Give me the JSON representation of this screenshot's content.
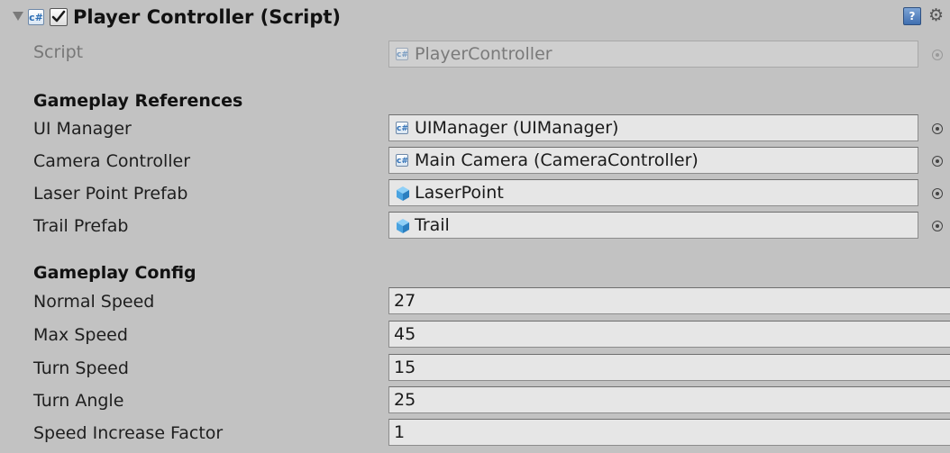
{
  "component": {
    "title": "Player Controller (Script)",
    "enabled": true,
    "script_label": "Script",
    "script_value": "PlayerController"
  },
  "sections": {
    "references_title": "Gameplay References",
    "config_title": "Gameplay Config"
  },
  "references": [
    {
      "label": "UI Manager",
      "value": "UIManager (UIManager)",
      "icon": "script-icon"
    },
    {
      "label": "Camera Controller",
      "value": "Main Camera (CameraController)",
      "icon": "script-icon"
    },
    {
      "label": "Laser Point Prefab",
      "value": "LaserPoint",
      "icon": "prefab-cube-icon"
    },
    {
      "label": "Trail Prefab",
      "value": "Trail",
      "icon": "prefab-cube-icon"
    }
  ],
  "config": [
    {
      "label": "Normal Speed",
      "value": "27"
    },
    {
      "label": "Max Speed",
      "value": "45"
    },
    {
      "label": "Turn Speed",
      "value": "15"
    },
    {
      "label": "Turn Angle",
      "value": "25"
    },
    {
      "label": "Speed Increase Factor",
      "value": "1"
    }
  ],
  "icons": {
    "script_glyph": "c#",
    "help_glyph": "?",
    "gear_glyph": "⚙"
  },
  "colors": {
    "panel_bg": "#c2c2c2",
    "field_bg": "#e6e6e6",
    "script_icon_blue": "#2f6fb5",
    "prefab_cube_blue": "#4aa3e0"
  }
}
